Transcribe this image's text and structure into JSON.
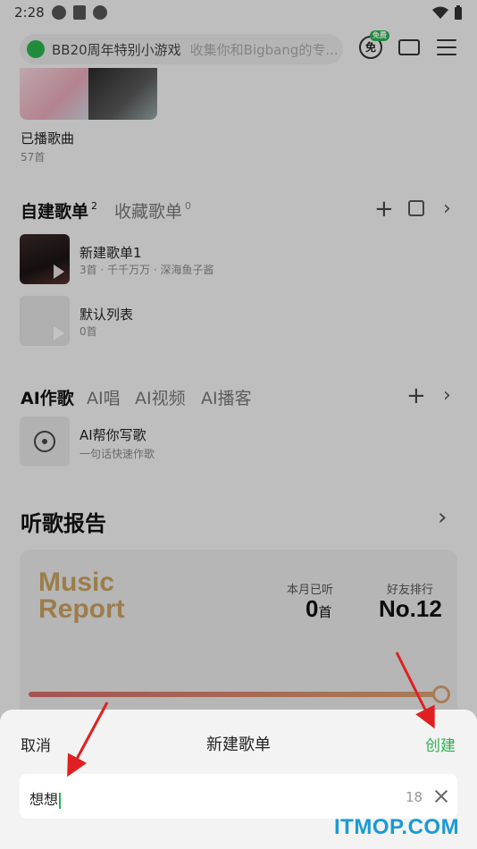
{
  "status_bar": {
    "time": "2:28"
  },
  "header": {
    "search_text": "BB20周年特别小游戏",
    "search_hint": "收集你和Bigbang的专...",
    "vip_label": "免",
    "vip_badge": "免费"
  },
  "played": {
    "title": "已播歌曲",
    "count": "57首"
  },
  "playlists": {
    "tab_self": "自建歌单",
    "tab_self_count": "2",
    "tab_fav": "收藏歌单",
    "tab_fav_count": "0",
    "items": [
      {
        "name": "新建歌单1",
        "sub": "3首 · 千千万万 · 深海鱼子酱"
      },
      {
        "name": "默认列表",
        "sub": "0首"
      }
    ]
  },
  "ai": {
    "tabs": [
      "AI作歌",
      "AI唱",
      "AI视频",
      "AI播客"
    ],
    "item_title": "AI帮你写歌",
    "item_sub": "一句话快速作歌"
  },
  "report": {
    "title": "听歌报告",
    "logo_line1": "Music",
    "logo_line2": "Report",
    "month_label": "本月已听",
    "month_value": "0",
    "month_unit": "首",
    "rank_label": "好友排行",
    "rank_value": "No.12"
  },
  "sheet": {
    "cancel": "取消",
    "title": "新建歌单",
    "create": "创建",
    "input_value": "想想",
    "char_count": "18"
  },
  "watermark": "ITMOP.COM",
  "colors": {
    "accent": "#2bb24c",
    "report_gold": "#c8a060",
    "annotation_red": "#e02020",
    "watermark": "#1a9ad6"
  }
}
